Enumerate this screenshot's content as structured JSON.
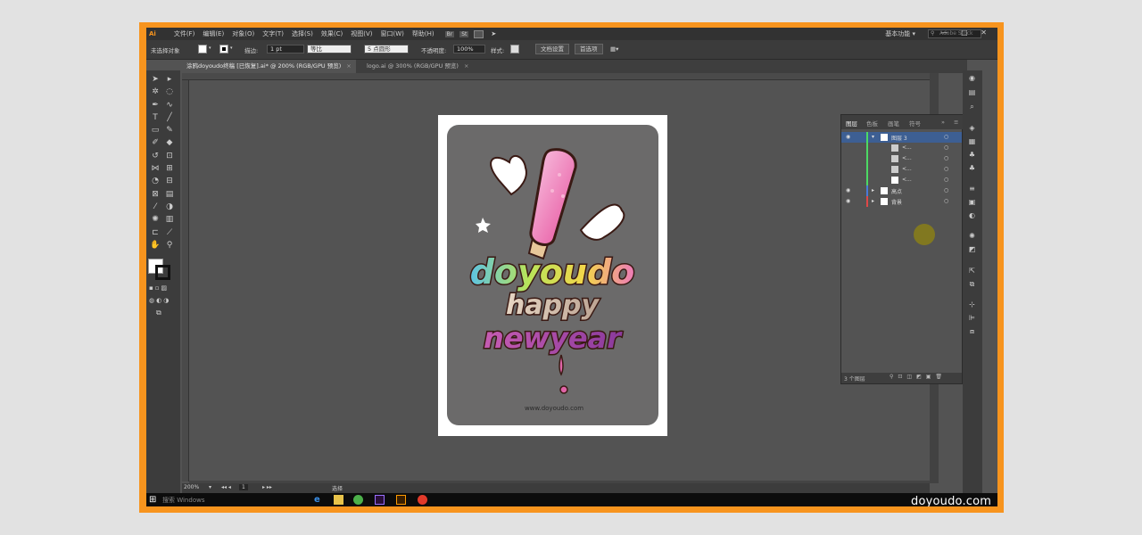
{
  "menubar": {
    "app_icon": "Ai",
    "items": [
      "文件(F)",
      "编辑(E)",
      "对象(O)",
      "文字(T)",
      "选择(S)",
      "效果(C)",
      "视图(V)",
      "窗口(W)",
      "帮助(H)"
    ],
    "icon_a": "Br",
    "icon_b": "St",
    "workspace": "基本功能 ▾",
    "search_placeholder": "Adobe Stock",
    "window_controls": "— □ ✕"
  },
  "control_bar": {
    "selection": "未选择对象",
    "stroke_label": "描边:",
    "stroke_value": "1 pt",
    "stroke_profile": "等比",
    "brush": "5 点圆形",
    "opacity_label": "不透明度:",
    "opacity_value": "100%",
    "style_label": "样式:",
    "doc_setup_button": "文档设置",
    "prefs_button": "首选项"
  },
  "tabs": [
    {
      "label": "涂鸦doyoudo终稿 [已恢复].ai* @ 200% (RGB/GPU 预览)",
      "close": "×"
    },
    {
      "label": "logo.ai @ 300% (RGB/GPU 预览)",
      "close": "×"
    }
  ],
  "artwork": {
    "line1": "doyoudo",
    "line2": "happy",
    "line3": "newyear",
    "url": "www.doyoudo.com"
  },
  "layers_panel": {
    "tabs": [
      "图层",
      "色板",
      "画笔",
      "符号"
    ],
    "rows": [
      {
        "name": "图层 3",
        "indent": 0
      },
      {
        "name": "<...",
        "indent": 1
      },
      {
        "name": "<...",
        "indent": 1
      },
      {
        "name": "<...",
        "indent": 1
      },
      {
        "name": "<...",
        "indent": 1
      },
      {
        "name": "高点",
        "indent": 0
      },
      {
        "name": "背景",
        "indent": 0
      }
    ],
    "footer": "3 个图层"
  },
  "status_bar": {
    "zoom": "200%",
    "page": "1",
    "mode": "选择"
  },
  "taskbar": {
    "search": "搜索 Windows"
  },
  "watermark": "doyoudo.com",
  "colors": {
    "frame": "#f7941e",
    "ui_dark": "#323232",
    "canvas": "#535353",
    "selected_row": "#3d5f93",
    "card_gray": "#6b6a6a"
  }
}
